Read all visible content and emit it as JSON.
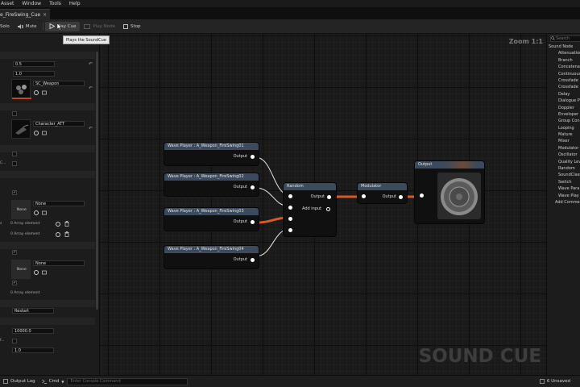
{
  "menu": [
    "Asset",
    "Window",
    "Tools",
    "Help"
  ],
  "tab": {
    "title": "e_FireSwing_Cue",
    "close": "×"
  },
  "toolbar": {
    "solo": "Solo",
    "mute": "Mute",
    "play_cue": "Play Cue",
    "play_node": "Play Node",
    "stop": "Stop"
  },
  "tooltip": "Plays the SoundCue",
  "details": {
    "volume": "0.5",
    "pitch": "1.0",
    "sound_class": "SC_Weapon",
    "attenuation": "Character_ATT",
    "truncated_label": "C...",
    "none_a": "None",
    "none_select_a": "None",
    "array_a1": "0 Array element",
    "array_a2": "0 Array element",
    "array_a1_prefix": "s",
    "none_b": "None",
    "none_select_b": "None",
    "array_b1": "0 Array element",
    "virtualization": "Restart",
    "max_distance": "10000.0",
    "priority_label": "f...",
    "priority": "1.0"
  },
  "graph": {
    "zoom": "Zoom 1:1",
    "watermark": "SOUND CUE",
    "wave_players": [
      {
        "title": "Wave Player : A_Weapon_FireSwing01",
        "out": "Output"
      },
      {
        "title": "Wave Player : A_Weapon_FireSwing02",
        "out": "Output"
      },
      {
        "title": "Wave Player : A_Weapon_FireSwing03",
        "out": "Output"
      },
      {
        "title": "Wave Player : A_Weapon_FireSwing04",
        "out": "Output"
      }
    ],
    "random": {
      "title": "Random",
      "out": "Output",
      "add": "Add input"
    },
    "modulator": {
      "title": "Modulator",
      "out": "Output"
    },
    "output": {
      "title": "Output"
    }
  },
  "palette": {
    "search": "Search",
    "header": "Sound Node",
    "items": [
      "Attenuation",
      "Branch",
      "Concatenator",
      "Continuous",
      "Crossfade",
      "Crossfade",
      "Delay",
      "Dialogue Pl",
      "Doppler",
      "Enveloper",
      "Group Con",
      "Looping",
      "Mature",
      "Mixer",
      "Modulator",
      "Oscillator",
      "Quality Lev",
      "Random",
      "SoundClass",
      "Switch",
      "Wave Para",
      "Wave Play"
    ],
    "footer": "Add Comment"
  },
  "status": {
    "output_log": "Output Log",
    "cmd": "Cmd",
    "console_placeholder": "Enter Console Command",
    "unsaved": "6 Unsaved"
  }
}
